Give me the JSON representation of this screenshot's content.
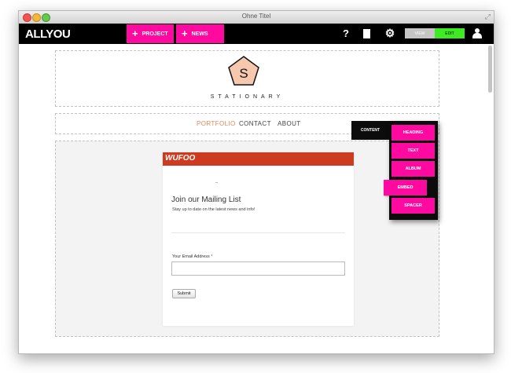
{
  "window": {
    "title": "Ohne Titel"
  },
  "toolbar": {
    "logo": "ALLYOU",
    "project_label": "PROJECT",
    "news_label": "NEWS",
    "help_label": "?",
    "view_label": "VIEW",
    "edit_label": "EDIT",
    "colors": {
      "accent": "#ff0aa0",
      "edit": "#3eea22",
      "view": "#c6c6c6",
      "bar": "#000000"
    }
  },
  "site": {
    "logo_letter": "S",
    "brand": "STATIONARY",
    "nav": [
      "PORTFOLIO",
      "CONTACT",
      "ABOUT"
    ],
    "active_nav_color": "#e08a5c"
  },
  "form": {
    "provider": "WUFOO",
    "title": "Join our Mailing List",
    "subtitle": "Stay up to date on the latest news and info!",
    "email_label": "Your Email Address",
    "required_mark": "*",
    "email_value": "",
    "submit_label": "Submit"
  },
  "content_menu": {
    "tab_label": "CONTENT",
    "items": [
      "HEADING",
      "TEXT",
      "ALBUM",
      "EMBED",
      "SPACER"
    ]
  }
}
